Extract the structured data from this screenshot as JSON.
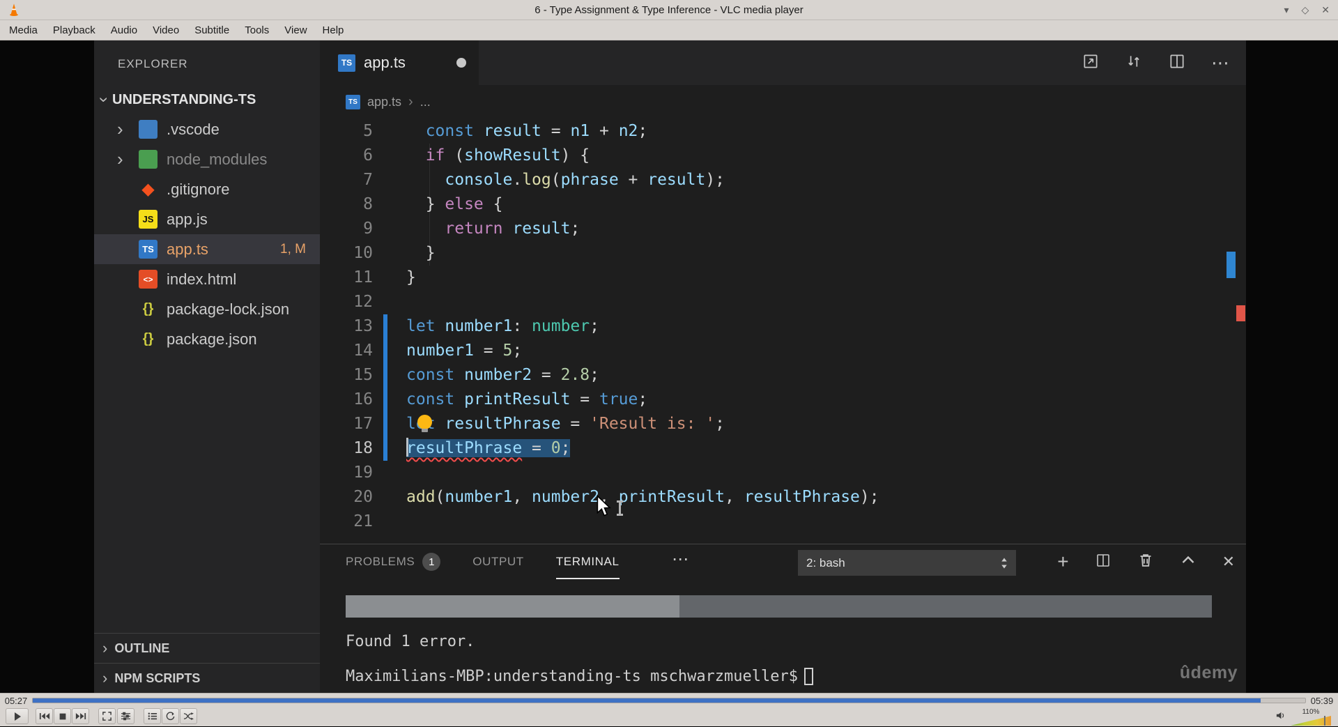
{
  "icons": {
    "chevron_right": "›",
    "more_horizontal": "⋯",
    "plus": "+",
    "close": "✕",
    "window_min": "▾",
    "window_max": "◇",
    "window_close": "✕",
    "ts_badge": "TS",
    "js_badge": "JS",
    "json_braces": "{}",
    "html_tags": "<>",
    "git_diamond": "◆"
  },
  "colors": {
    "accent_blue": "#3e71c4",
    "selection_blue": "#26537a",
    "error_red": "#f14c4c",
    "modified_file": "#e8a268",
    "gutter_modified": "#2a7fd4",
    "token": {
      "kw": "#569cd6",
      "ctrl": "#c586c0",
      "var": "#9cdcfe",
      "fn": "#dcdcaa",
      "num": "#b5cea8",
      "str": "#ce9178",
      "type": "#4ec9b0",
      "plain": "#d4d4d4"
    }
  },
  "vlc": {
    "window_title": "6 - Type Assignment & Type Inference - VLC media player",
    "menu_items": [
      "Media",
      "Playback",
      "Audio",
      "Video",
      "Subtitle",
      "Tools",
      "View",
      "Help"
    ],
    "time_elapsed": "05:27",
    "time_total": "05:39",
    "progress_percent": 96.5,
    "volume_label": "110%"
  },
  "vscode": {
    "explorer": {
      "title": "EXPLORER",
      "root_label": "UNDERSTANDING-TS",
      "items": [
        {
          "label": ".vscode",
          "kind": "folder",
          "icon": "vscode-folder-icon"
        },
        {
          "label": "node_modules",
          "kind": "folder",
          "icon": "node-folder-icon",
          "dimmed": true
        },
        {
          "label": ".gitignore",
          "kind": "file",
          "icon": "git-icon"
        },
        {
          "label": "app.js",
          "kind": "file",
          "icon": "js-icon"
        },
        {
          "label": "app.ts",
          "kind": "file",
          "icon": "ts-icon",
          "selected": true,
          "modified": true,
          "badge": "1, M"
        },
        {
          "label": "index.html",
          "kind": "file",
          "icon": "html-icon"
        },
        {
          "label": "package-lock.json",
          "kind": "file",
          "icon": "json-icon"
        },
        {
          "label": "package.json",
          "kind": "file",
          "icon": "json-icon"
        }
      ],
      "bottom_sections": [
        "OUTLINE",
        "NPM SCRIPTS"
      ]
    },
    "editor": {
      "tab_label": "app.ts",
      "breadcrumb_file": "app.ts",
      "breadcrumb_more": "...",
      "code_lines": [
        {
          "num": "5",
          "tokens": [
            [
              "  ",
              "plain"
            ],
            [
              "const",
              "kw"
            ],
            [
              " ",
              "plain"
            ],
            [
              "result",
              "var"
            ],
            [
              " = ",
              "plain"
            ],
            [
              "n1",
              "var"
            ],
            [
              " + ",
              "plain"
            ],
            [
              "n2",
              "var"
            ],
            [
              ";",
              "plain"
            ]
          ]
        },
        {
          "num": "6",
          "tokens": [
            [
              "  ",
              "plain"
            ],
            [
              "if",
              "ctrl"
            ],
            [
              " (",
              "plain"
            ],
            [
              "showResult",
              "var"
            ],
            [
              ") {",
              "plain"
            ]
          ]
        },
        {
          "num": "7",
          "tokens": [
            [
              "    ",
              "plain"
            ],
            [
              "console",
              "var"
            ],
            [
              ".",
              "plain"
            ],
            [
              "log",
              "fn"
            ],
            [
              "(",
              "plain"
            ],
            [
              "phrase",
              "var"
            ],
            [
              " + ",
              "plain"
            ],
            [
              "result",
              "var"
            ],
            [
              ");",
              "plain"
            ]
          ]
        },
        {
          "num": "8",
          "tokens": [
            [
              "  } ",
              "plain"
            ],
            [
              "else",
              "ctrl"
            ],
            [
              " {",
              "plain"
            ]
          ]
        },
        {
          "num": "9",
          "tokens": [
            [
              "    ",
              "plain"
            ],
            [
              "return",
              "ctrl"
            ],
            [
              " ",
              "plain"
            ],
            [
              "result",
              "var"
            ],
            [
              ";",
              "plain"
            ]
          ]
        },
        {
          "num": "10",
          "tokens": [
            [
              "  }",
              "plain"
            ]
          ]
        },
        {
          "num": "11",
          "tokens": [
            [
              "}",
              "plain"
            ]
          ]
        },
        {
          "num": "12",
          "tokens": []
        },
        {
          "num": "13",
          "modified": true,
          "tokens": [
            [
              "let",
              "kw"
            ],
            [
              " ",
              "plain"
            ],
            [
              "number1",
              "var"
            ],
            [
              ": ",
              "plain"
            ],
            [
              "number",
              "type"
            ],
            [
              ";",
              "plain"
            ]
          ]
        },
        {
          "num": "14",
          "modified": true,
          "tokens": [
            [
              "number1",
              "var"
            ],
            [
              " = ",
              "plain"
            ],
            [
              "5",
              "num"
            ],
            [
              ";",
              "plain"
            ]
          ]
        },
        {
          "num": "15",
          "modified": true,
          "tokens": [
            [
              "const",
              "kw"
            ],
            [
              " ",
              "plain"
            ],
            [
              "number2",
              "var"
            ],
            [
              " = ",
              "plain"
            ],
            [
              "2.8",
              "num"
            ],
            [
              ";",
              "plain"
            ]
          ]
        },
        {
          "num": "16",
          "modified": true,
          "tokens": [
            [
              "const",
              "kw"
            ],
            [
              " ",
              "plain"
            ],
            [
              "printResult",
              "var"
            ],
            [
              " = ",
              "plain"
            ],
            [
              "true",
              "kw"
            ],
            [
              ";",
              "plain"
            ]
          ]
        },
        {
          "num": "17",
          "modified": true,
          "bulb": true,
          "tokens": [
            [
              "let",
              "kw"
            ],
            [
              " ",
              "plain"
            ],
            [
              "resultPhrase",
              "var"
            ],
            [
              " = ",
              "plain"
            ],
            [
              "'Result is: '",
              "str"
            ],
            [
              ";",
              "plain"
            ]
          ]
        },
        {
          "num": "18",
          "modified": true,
          "selected": true,
          "cursor": true,
          "active": true,
          "tokens": [
            [
              "resultPhrase",
              "var",
              "squiggle"
            ],
            [
              " = ",
              "plain"
            ],
            [
              "0",
              "num"
            ],
            [
              ";",
              "plain"
            ]
          ]
        },
        {
          "num": "19",
          "tokens": []
        },
        {
          "num": "20",
          "tokens": [
            [
              "add",
              "fn"
            ],
            [
              "(",
              "plain"
            ],
            [
              "number1",
              "var"
            ],
            [
              ", ",
              "plain"
            ],
            [
              "number2",
              "var"
            ],
            [
              ", ",
              "plain"
            ],
            [
              "printResult",
              "var"
            ],
            [
              ", ",
              "plain"
            ],
            [
              "resultPhrase",
              "var"
            ],
            [
              ");",
              "plain"
            ]
          ]
        },
        {
          "num": "21",
          "tokens": []
        }
      ]
    },
    "panel": {
      "tabs": [
        {
          "label": "PROBLEMS",
          "badge": "1"
        },
        {
          "label": "OUTPUT"
        },
        {
          "label": "TERMINAL",
          "active": true
        }
      ],
      "shell_selector": "2: bash",
      "terminal_output": "Found 1 error.",
      "terminal_prompt": "Maximilians-MBP:understanding-ts mschwarzmueller$",
      "watermark": "ûdemy"
    }
  }
}
